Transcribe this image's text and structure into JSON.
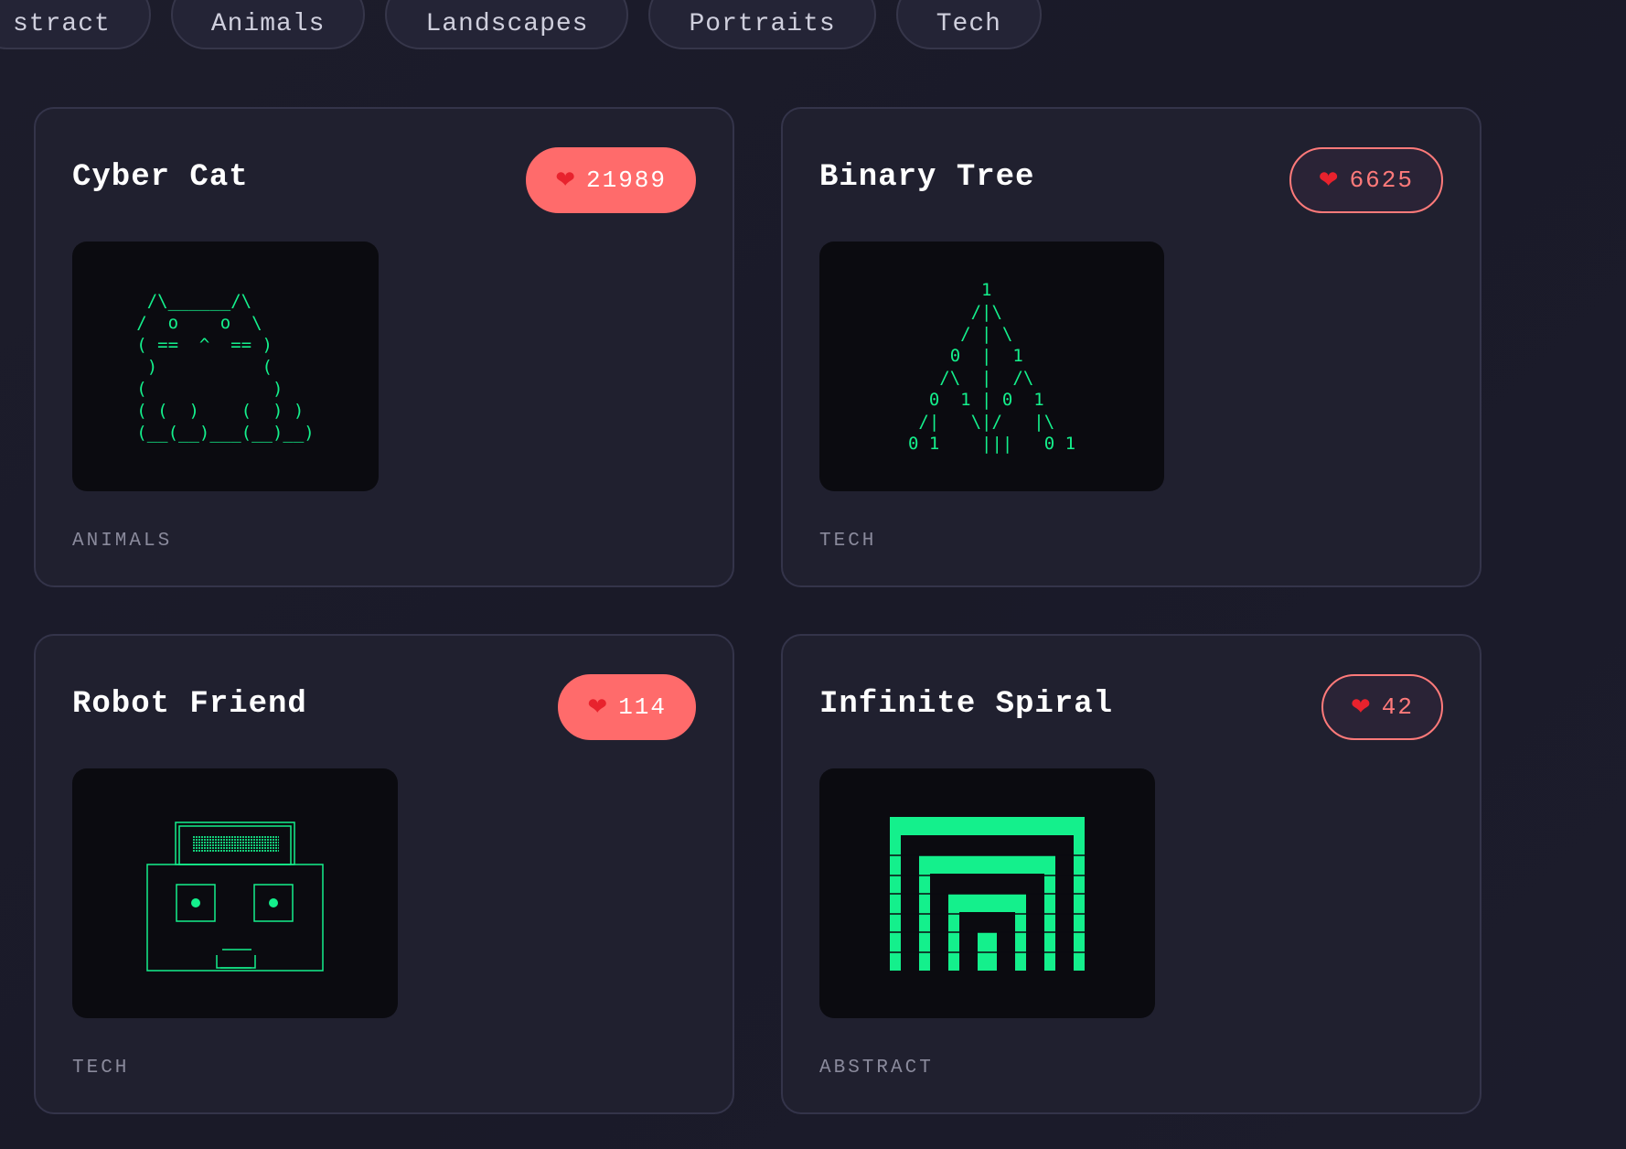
{
  "colors": {
    "accent": "#ff6b6b",
    "art_green": "#14f08c",
    "card_bg": "#20202f",
    "page_bg": "#1c1c2b"
  },
  "filters": [
    {
      "label": "stract"
    },
    {
      "label": "Animals"
    },
    {
      "label": "Landscapes"
    },
    {
      "label": "Portraits"
    },
    {
      "label": "Tech"
    }
  ],
  "cards": [
    {
      "title": "Cyber Cat",
      "likes": "21989",
      "liked": true,
      "category": "ANIMALS",
      "art": " /\\______/\\\n/  o    o  \\\n( ==  ^  == )\n )          (\n(            )\n( (  )    (  ) )\n(__(__)___(__)__)"
    },
    {
      "title": "Binary Tree",
      "likes": "6625",
      "liked": false,
      "category": "TECH",
      "art": "       1\n      /|\\\n     / | \\\n    0  |  1\n   /\\  |  /\\\n  0  1 | 0  1\n /|   \\|/   |\\\n0 1    |||   0 1"
    },
    {
      "title": "Robot Friend",
      "likes": "114",
      "liked": true,
      "category": "TECH",
      "art": "robot"
    },
    {
      "title": "Infinite Spiral",
      "likes": "42",
      "liked": false,
      "category": "ABSTRACT",
      "art": "spiral"
    }
  ],
  "icons": {
    "like": "heart-icon"
  },
  "heart_glyph": "❤"
}
